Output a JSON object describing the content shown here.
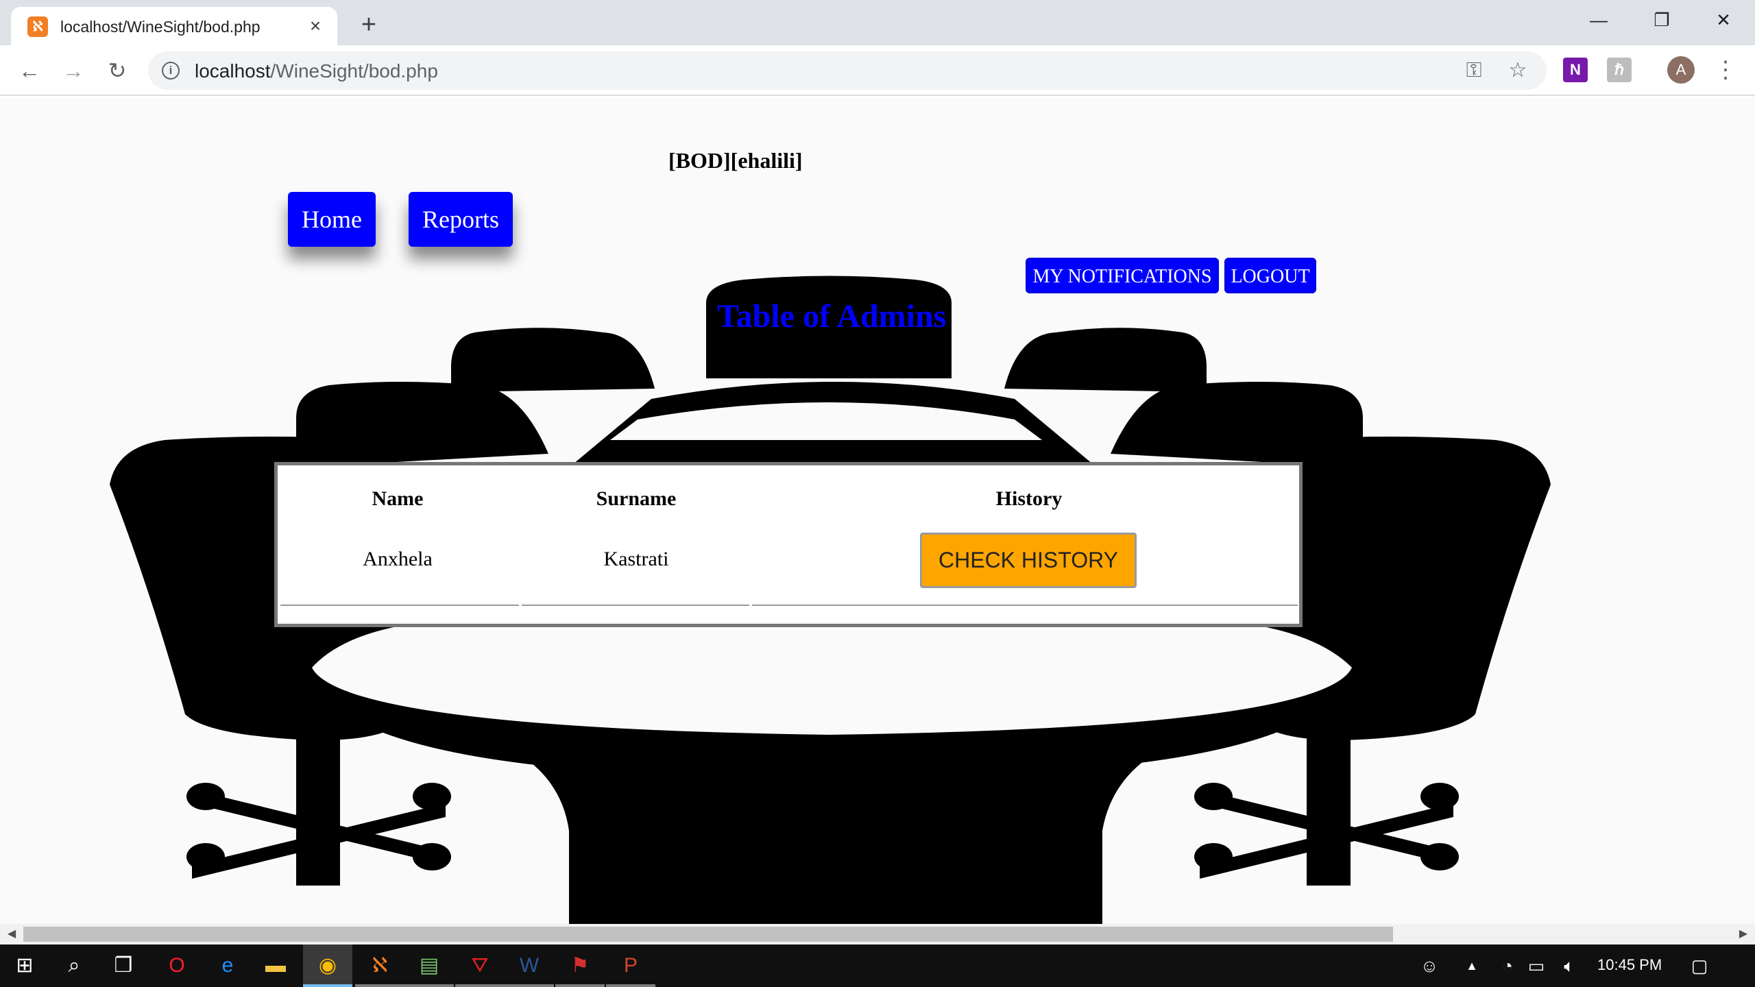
{
  "browser": {
    "tab_title": "localhost/WineSight/bod.php",
    "tab_favicon": "xampp-icon",
    "new_tab": "+",
    "url_host": "localhost",
    "url_path": "/WineSight/bod.php",
    "window_controls": {
      "minimize": "—",
      "restore": "❐",
      "close": "✕"
    },
    "avatar_letter": "A"
  },
  "page": {
    "user_tag": "[BOD][ehalili]",
    "nav": {
      "home": "Home",
      "reports": "Reports"
    },
    "actions": {
      "notifications": "MY NOTIFICATIONS",
      "logout": "LOGOUT"
    },
    "table_title": "Table of Admins",
    "table": {
      "headers": [
        "Name",
        "Surname",
        "History"
      ],
      "rows": [
        {
          "name": "Anxhela",
          "surname": "Kastrati",
          "history_button": "CHECK HISTORY"
        }
      ]
    },
    "colors": {
      "nav_blue": "#0000ff",
      "history_button": "#ffa500",
      "title_blue": "#0000ff"
    }
  },
  "taskbar": {
    "clock": "10:45 PM",
    "apps": [
      "start-icon",
      "search-icon",
      "task-view-icon",
      "opera-icon",
      "edge-icon",
      "file-explorer-icon",
      "chrome-icon",
      "xampp-icon",
      "notepad-icon",
      "acrobat-icon",
      "word-icon",
      "flag-app-icon",
      "powerpoint-icon"
    ]
  }
}
